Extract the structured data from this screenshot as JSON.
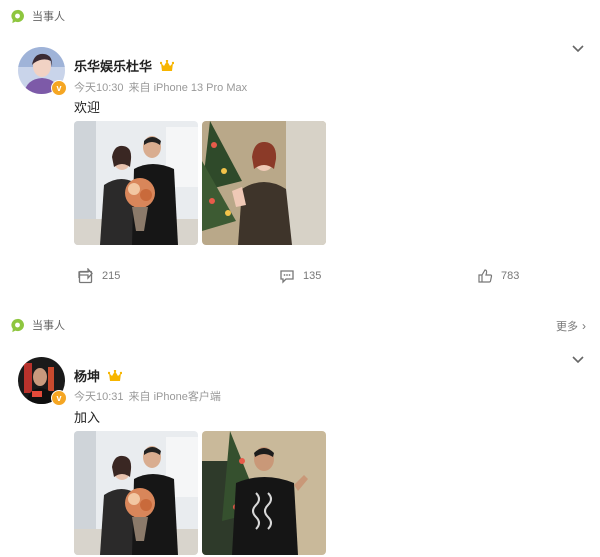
{
  "post1": {
    "tag": "当事人",
    "username": "乐华娱乐杜华",
    "time": "今天10:30",
    "source": "来自 iPhone 13 Pro Max",
    "content": "欢迎",
    "repost_count": "215",
    "comment_count": "135",
    "like_count": "783"
  },
  "post2": {
    "tag": "当事人",
    "more": "更多",
    "username": "杨坤",
    "time": "今天10:31",
    "source": "来自 iPhone客户端",
    "content": "加入"
  },
  "colors": {
    "tag_green": "#8ec63f",
    "verified_orange": "#f5a623",
    "crown_gold": "#f7b500"
  },
  "icons": [
    "speech-bubble-icon",
    "chevron-down-icon",
    "crown-icon",
    "verified-badge-icon",
    "repost-icon",
    "comment-icon",
    "like-icon",
    "chevron-right-icon"
  ]
}
